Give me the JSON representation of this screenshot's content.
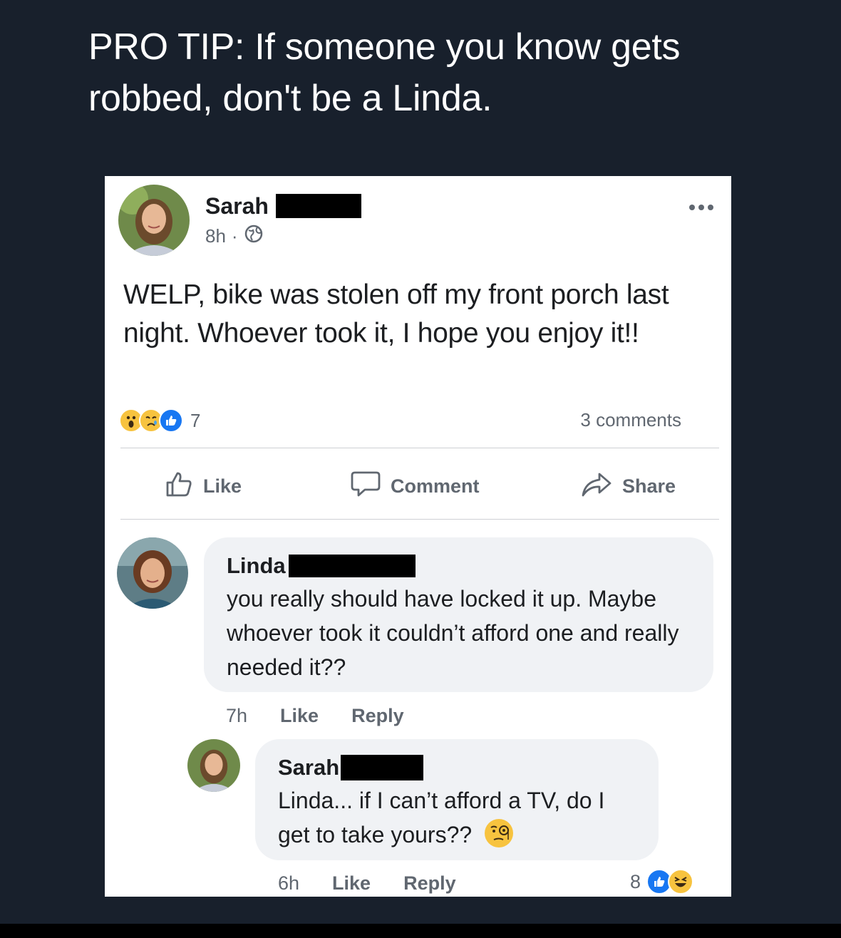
{
  "caption": "PRO TIP: If someone you know gets robbed, don't be a Linda.",
  "post": {
    "author": "Sarah",
    "time": "8h",
    "separator": "·",
    "text": "WELP, bike was stolen off my front porch last night. Whoever took it, I hope you enjoy it!!",
    "reaction_count": "7",
    "reaction_icons": [
      "wow-icon",
      "sad-icon",
      "like-icon"
    ],
    "comments_count": "3 comments",
    "actions": {
      "like": "Like",
      "comment": "Comment",
      "share": "Share"
    }
  },
  "comments": [
    {
      "author": "Linda",
      "text": "you really should have locked it up. Maybe whoever took it couldn’t afford one and really needed it??",
      "time": "7h",
      "like": "Like",
      "reply": "Reply"
    }
  ],
  "reply": {
    "author": "Sarah",
    "text": "Linda... if I can’t afford a TV, do I get to take yours??",
    "emoji": "face-with-monocle-icon",
    "time": "6h",
    "like": "Like",
    "reply": "Reply",
    "reaction_count": "8",
    "reaction_icons": [
      "like-icon",
      "laugh-icon"
    ]
  },
  "colors": {
    "background": "#18202c",
    "card": "#ffffff",
    "bubble": "#f0f2f5",
    "text": "#1c1e21",
    "muted": "#606770",
    "like_blue": "#1877f2",
    "reaction_yellow": "#f7c33f"
  }
}
